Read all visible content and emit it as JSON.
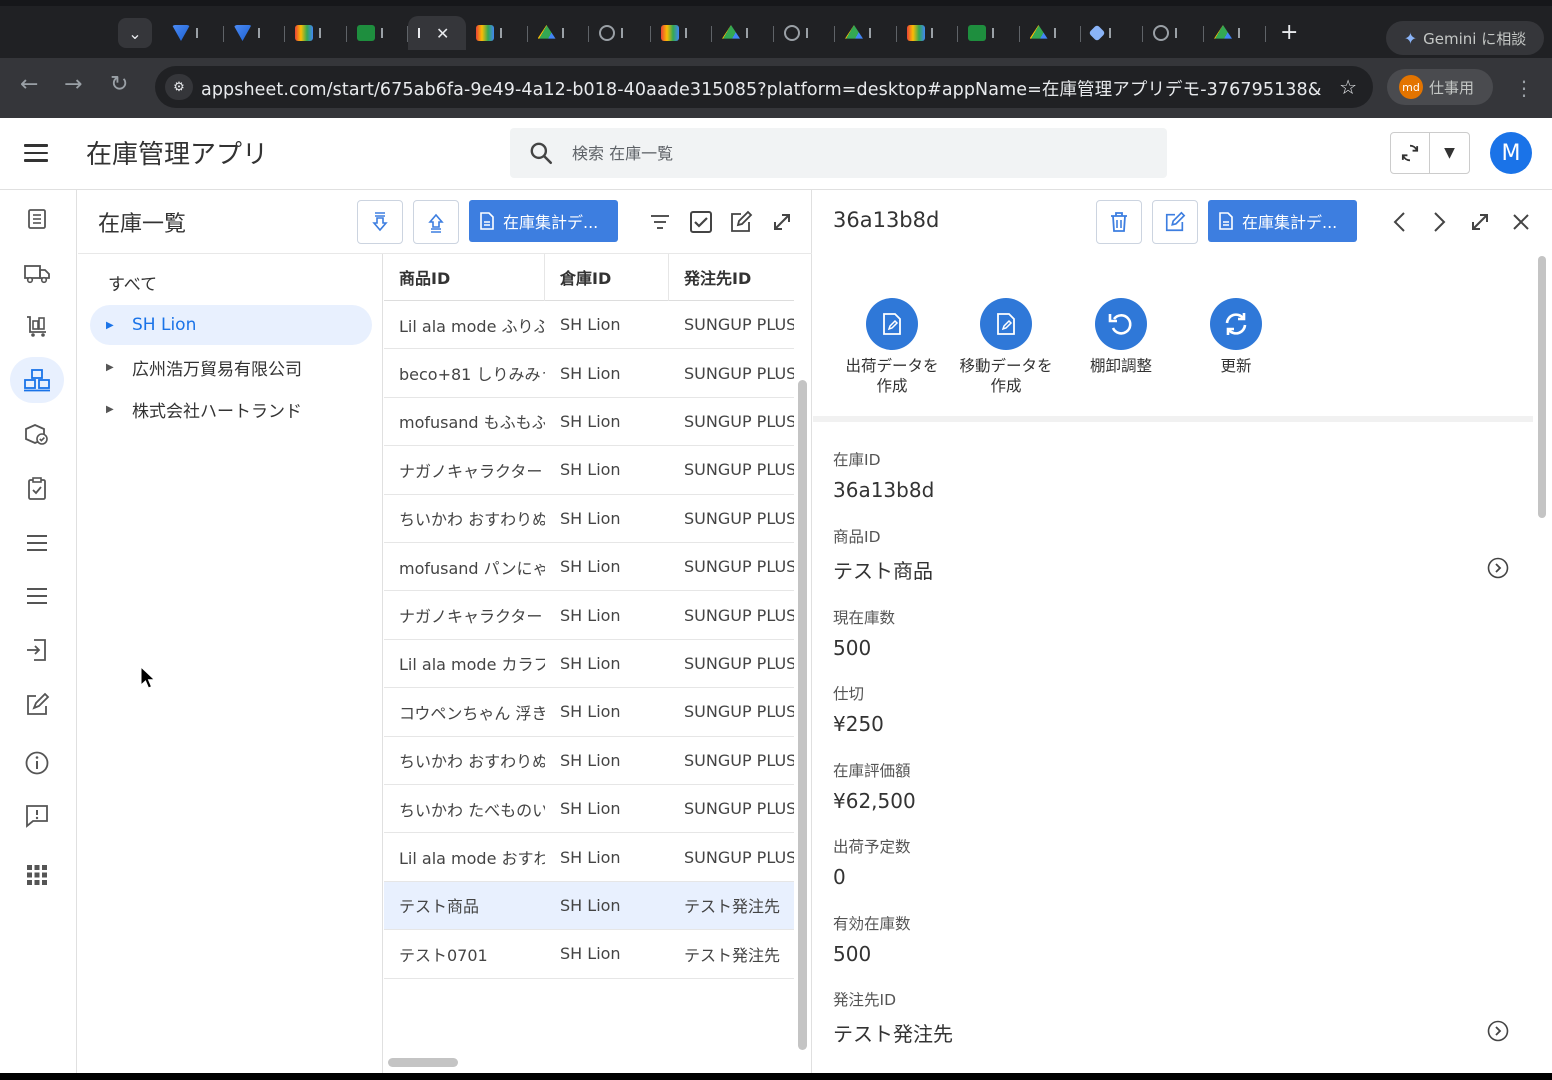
{
  "browser": {
    "gemini_label": "Gemini に相談",
    "url": "appsheet.com/start/675ab6fa-9e49-4a12-b018-40aade315085?platform=desktop#appName=在庫管理アプリデモ-376795138&vss...",
    "profile_initials": "md",
    "profile_label": "仕事用"
  },
  "app": {
    "title": "在庫管理アプリ",
    "search_placeholder": "検索 在庫一覧",
    "user_initial": "M"
  },
  "list": {
    "title": "在庫一覧",
    "report_button": "在庫集計デ...",
    "tree": {
      "all_label": "すべて",
      "groups": [
        "SH Lion",
        "広州浩万貿易有限公司",
        "株式会社ハートランド"
      ]
    },
    "columns": [
      "商品ID",
      "倉庫ID",
      "発注先ID"
    ],
    "rows": [
      [
        "Lil ala mode ふりふ",
        "SH Lion",
        "SUNGUP PLUS"
      ],
      [
        "beco+81 しりみみう",
        "SH Lion",
        "SUNGUP PLUS"
      ],
      [
        "mofusand もふもふ",
        "SH Lion",
        "SUNGUP PLUS"
      ],
      [
        "ナガノキャラクター",
        "SH Lion",
        "SUNGUP PLUS"
      ],
      [
        "ちいかわ おすわりぬ",
        "SH Lion",
        "SUNGUP PLUS"
      ],
      [
        "mofusand パンにゃ",
        "SH Lion",
        "SUNGUP PLUS"
      ],
      [
        "ナガノキャラクター",
        "SH Lion",
        "SUNGUP PLUS"
      ],
      [
        "Lil ala mode カラフ",
        "SH Lion",
        "SUNGUP PLUS"
      ],
      [
        "コウペンちゃん 浮き",
        "SH Lion",
        "SUNGUP PLUS"
      ],
      [
        "ちいかわ おすわりぬ",
        "SH Lion",
        "SUNGUP PLUS"
      ],
      [
        "ちいかわ たべものい",
        "SH Lion",
        "SUNGUP PLUS"
      ],
      [
        "Lil ala mode おすわ",
        "SH Lion",
        "SUNGUP PLUS"
      ],
      [
        "テスト商品",
        "SH Lion",
        "テスト発注先"
      ],
      [
        "テスト0701",
        "SH Lion",
        "テスト発注先"
      ]
    ]
  },
  "detail": {
    "title": "36a13b8d",
    "report_button": "在庫集計デ...",
    "actions": [
      {
        "label": "出荷データを\n作成",
        "icon": "document-edit-icon"
      },
      {
        "label": "移動データを\n作成",
        "icon": "document-edit-icon"
      },
      {
        "label": "棚卸調整",
        "icon": "undo-icon"
      },
      {
        "label": "更新",
        "icon": "refresh-icon"
      }
    ],
    "fields": [
      {
        "label": "在庫ID",
        "value": "36a13b8d"
      },
      {
        "label": "商品ID",
        "value": "テスト商品"
      },
      {
        "label": "現在庫数",
        "value": "500"
      },
      {
        "label": "仕切",
        "value": "¥250"
      },
      {
        "label": "在庫評価額",
        "value": "¥62,500"
      },
      {
        "label": "出荷予定数",
        "value": "0"
      },
      {
        "label": "有効在庫数",
        "value": "500"
      },
      {
        "label": "発注先ID",
        "value": "テスト発注先"
      }
    ]
  },
  "colors": {
    "accent": "#1a73e8",
    "button": "#3d7ee0",
    "selection": "#e8f0fe"
  }
}
